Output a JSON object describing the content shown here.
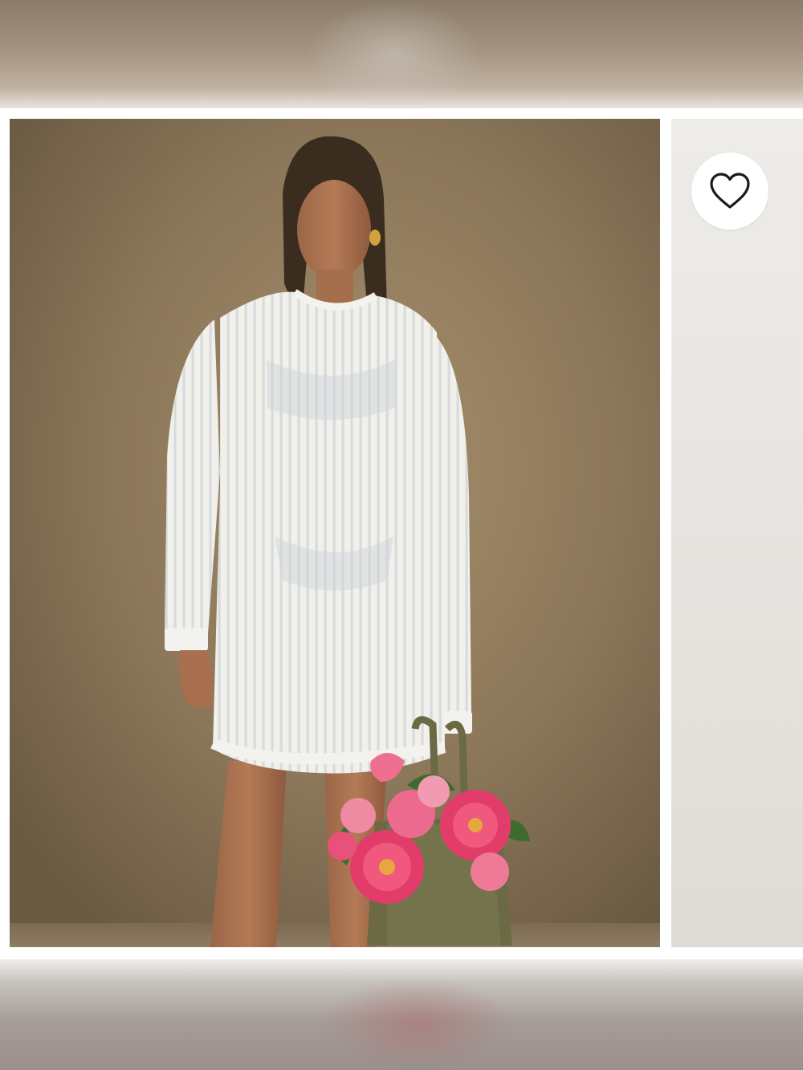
{
  "product_gallery": {
    "main_image": {
      "alt": "",
      "icon": "product-photo"
    },
    "next_image": {
      "icon": "product-photo-preview"
    },
    "favorite": {
      "icon": "heart-outline-icon",
      "color": "#1a1a1a"
    }
  },
  "colors": {
    "backdrop": "#8e7a5b",
    "garment": "#f3f1ec",
    "flowers": "#e23d6a",
    "bag": "#6b6a45"
  }
}
